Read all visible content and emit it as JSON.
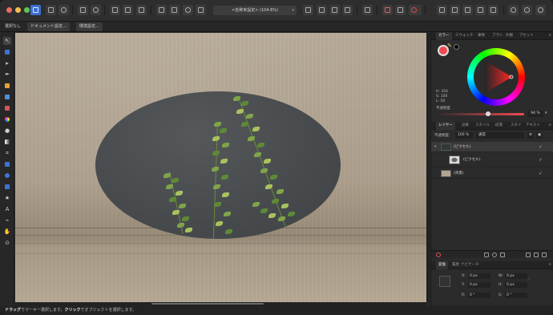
{
  "toolbar": {
    "document_title": "<名称未設定> (104.6%)",
    "caret": "▾"
  },
  "context": {
    "deselect": "選択なし",
    "document_setup": "ドキュメント設定...",
    "preferences": "環境設定..."
  },
  "color_panel": {
    "tabs": [
      "カラー",
      "スウォッチ",
      "筆致",
      "ブラシ",
      "外観",
      "アセット"
    ],
    "hsl": [
      "H: 354",
      "S: 100",
      "L: 50"
    ],
    "opacity_label": "不透明度",
    "opacity_value": "94 %",
    "opacity": 0.94,
    "colors": {
      "primary": "#f04b52",
      "secondary": "#000000"
    }
  },
  "layers_panel": {
    "tabs": [
      "レイヤー",
      "効果",
      "スタイル",
      "段落",
      "スタイ",
      "テキスト"
    ],
    "opacity_label": "不透明度:",
    "opacity_value": "100 %",
    "blend_mode": "通常",
    "layers": [
      {
        "name": "(ピクセル)",
        "indent": 0
      },
      {
        "name": "(ピクセル)",
        "indent": 1
      },
      {
        "name": "(背景)",
        "indent": 0
      }
    ]
  },
  "transform_panel": {
    "tabs": [
      "変換",
      "履歴",
      "ナビゲータ"
    ],
    "fields": {
      "x_label": "X:",
      "x_value": "0 px",
      "y_label": "Y:",
      "y_value": "0 px",
      "w_label": "W:",
      "w_value": "0 px",
      "h_label": "H:",
      "h_value": "0 px",
      "r_label": "R:",
      "r_value": "0 °",
      "s_label": "S:",
      "s_value": "0 °"
    }
  },
  "status": {
    "drag_bold": "ドラッグ",
    "drag_text": "でマーキー選択します。",
    "click_bold": "クリック",
    "click_text": "でオブジェクトを選択します。"
  }
}
